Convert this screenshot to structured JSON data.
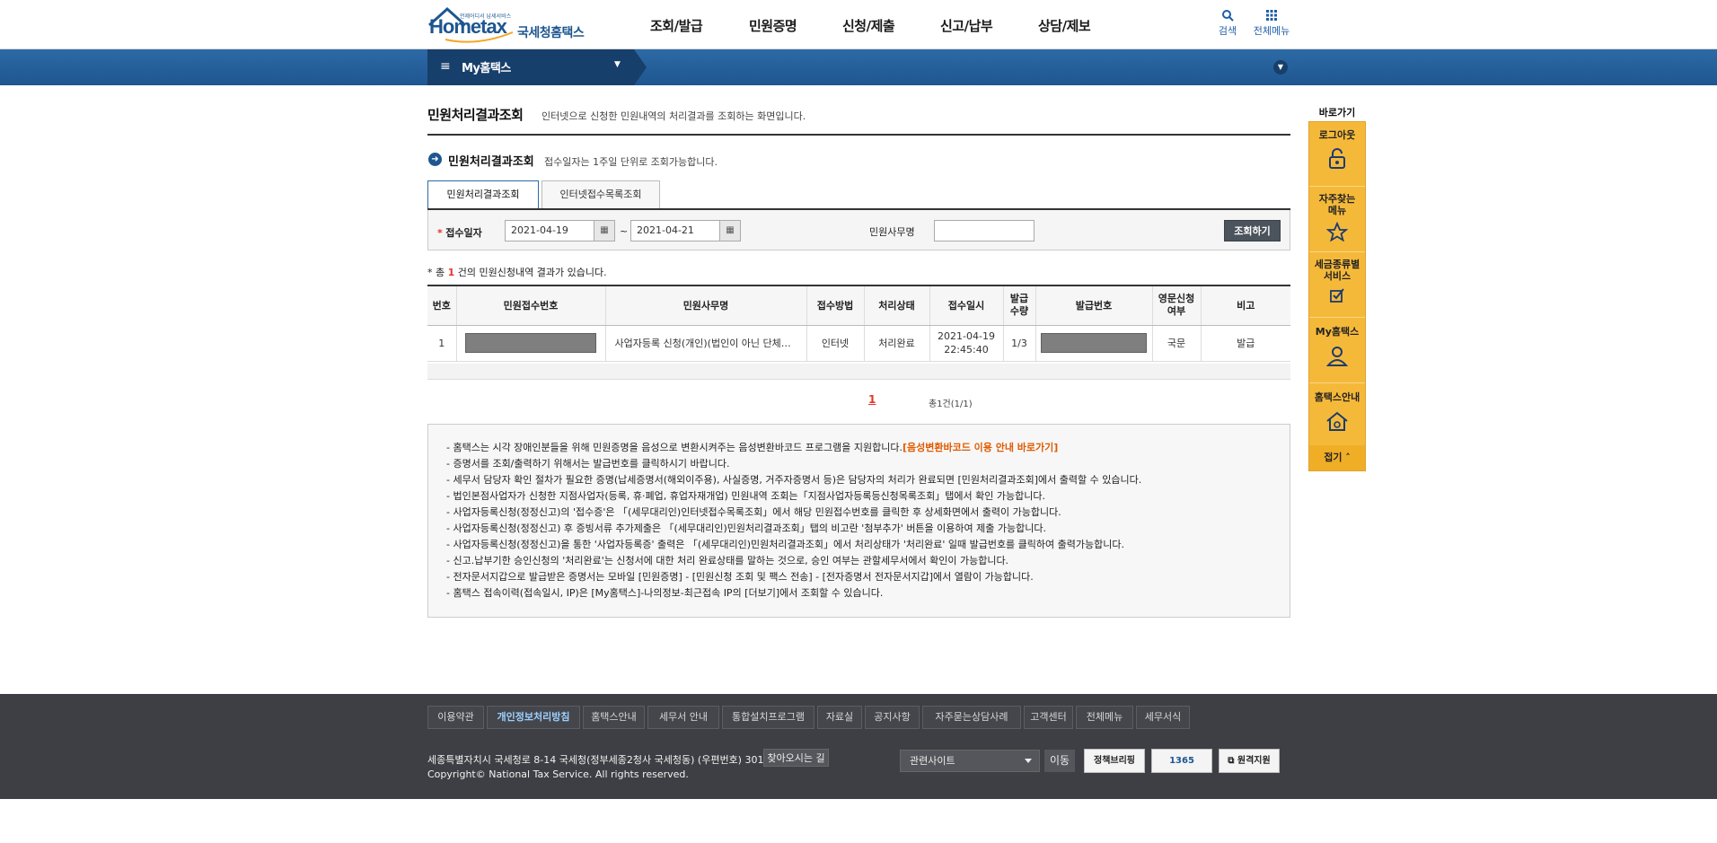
{
  "header": {
    "logo_text": "Hometax",
    "logo_sub": "국세청홈택스",
    "logo_tag": "언제어디서 납세서비스",
    "nav": [
      "조회/발급",
      "민원증명",
      "신청/제출",
      "신고/납부",
      "상담/제보"
    ],
    "search_label": "검색",
    "menu_label": "전체메뉴"
  },
  "mybar": {
    "label": "My홈택스"
  },
  "page": {
    "title": "민원처리결과조회",
    "description": "인터넷으로 신청한 민원내역의 처리결과를 조회하는 화면입니다.",
    "section_title": "민원처리결과조회",
    "section_desc": "접수일자는 1주일 단위로 조회가능합니다."
  },
  "tabs": [
    {
      "label": "민원처리결과조회",
      "active": true
    },
    {
      "label": "인터넷접수목록조회",
      "active": false
    }
  ],
  "search": {
    "date_label": "접수일자",
    "date_from": "2021-04-19",
    "date_sep": "~",
    "date_to": "2021-04-21",
    "name_label": "민원사무명",
    "name_value": "",
    "button": "조회하기"
  },
  "result": {
    "prefix": "* 총 ",
    "count": "1",
    "suffix": " 건의 민원신청내역 결과가 있습니다."
  },
  "table": {
    "headers": [
      "번호",
      "민원접수번호",
      "민원사무명",
      "접수방법",
      "처리상태",
      "접수일시",
      "발급\n수량",
      "발급번호",
      "영문신청\n여부",
      "비고"
    ],
    "rows": [
      {
        "no": "1",
        "service": "사업자등록 신청(개인)(법인이 아닌 단체…",
        "method": "인터넷",
        "status": "처리완료",
        "date": "2021-04-19",
        "time": "22:45:40",
        "qty": "1/3",
        "lang": "국문",
        "note": "발급"
      }
    ]
  },
  "pager": {
    "current": "1",
    "total": "총1건(1/1)"
  },
  "notice": {
    "first_text": "홈택스는 시각 장애인분들을 위해 민원증명을 음성으로 변환시켜주는 음성변환바코드 프로그램을 지원합니다.",
    "first_link": "[음성변환바코드 이용 안내 바로가기]",
    "items": [
      "증명서를 조회/출력하기 위해서는 발급번호를 클릭하시기 바랍니다.",
      "세무서 담당자 확인 절차가 필요한 증명(납세증명서(해외이주용), 사실증명, 거주자증명서 등)은 담당자의 처리가 완료되면 [민원처리결과조회]에서 출력할 수 있습니다.",
      "법인본점사업자가 신청한 지점사업자(등록, 휴·폐업, 휴업자재개업) 민원내역 조회는「지점사업자등록등신청목록조회」탭에서 확인 가능합니다.",
      "사업자등록신청(정정신고)의 '접수증'은 「(세무대리인)인터넷접수목록조회」에서 해당 민원접수번호를 클릭한 후 상세화면에서 출력이 가능합니다.",
      "사업자등록신청(정정신고) 후 증빙서류 추가제출은 「(세무대리인)민원처리결과조회」탭의 비고란 '첨부추가' 버튼을 이용하여 제출 가능합니다.",
      "사업자등록신청(정정신고)을 통한 '사업자등록증' 출력은 「(세무대리인)민원처리결과조회」에서 처리상태가 '처리완료' 일때 발급번호를 클릭하여 출력가능합니다.",
      "신고.납부기한 승인신청의 '처리완료'는 신청서에 대한 처리 완료상태를 말하는 것으로, 승인 여부는 관할세무서에서 확인이 가능합니다.",
      "전자문서지갑으로 발급받은 증명서는 모바일 [민원증명] - [민원신청 조회 및 팩스 전송] - [전자증명서 전자문서지갑]에서 열람이 가능합니다.",
      "홈택스 접속이력(접속일시, IP)은 [My홈택스]-나의정보-최근접속 IP의 [더보기]에서 조회할 수 있습니다."
    ]
  },
  "quick": {
    "title": "바로가기",
    "items": [
      "로그아웃",
      "자주찾는 메뉴",
      "세금종류별 서비스",
      "My홈택스",
      "홈택스안내"
    ],
    "fold": "접기"
  },
  "footer": {
    "links": [
      "이용약관",
      "개인정보처리방침",
      "홈택스안내",
      "세무서 안내",
      "통합설치프로그램",
      "자료실",
      "공지사항",
      "자주묻는상담사례",
      "고객센터",
      "전체메뉴",
      "세무서식"
    ],
    "address": "세종특별자치시 국세청로 8-14 국세청(정부세종2청사 국세청동) (우편번호) 30128",
    "find_btn": "찾아오시는 길",
    "copyright": "Copyright© National Tax Service. All rights reserved.",
    "site_select": "관련사이트",
    "go": "이동",
    "badges": [
      "정책브리핑",
      "1365",
      "원격지원"
    ]
  },
  "colors": {
    "brand_blue": "#1e5690",
    "accent_orange": "#f5b93a",
    "alert_red": "#e4352a",
    "footer_bg": "#3e3f44"
  }
}
